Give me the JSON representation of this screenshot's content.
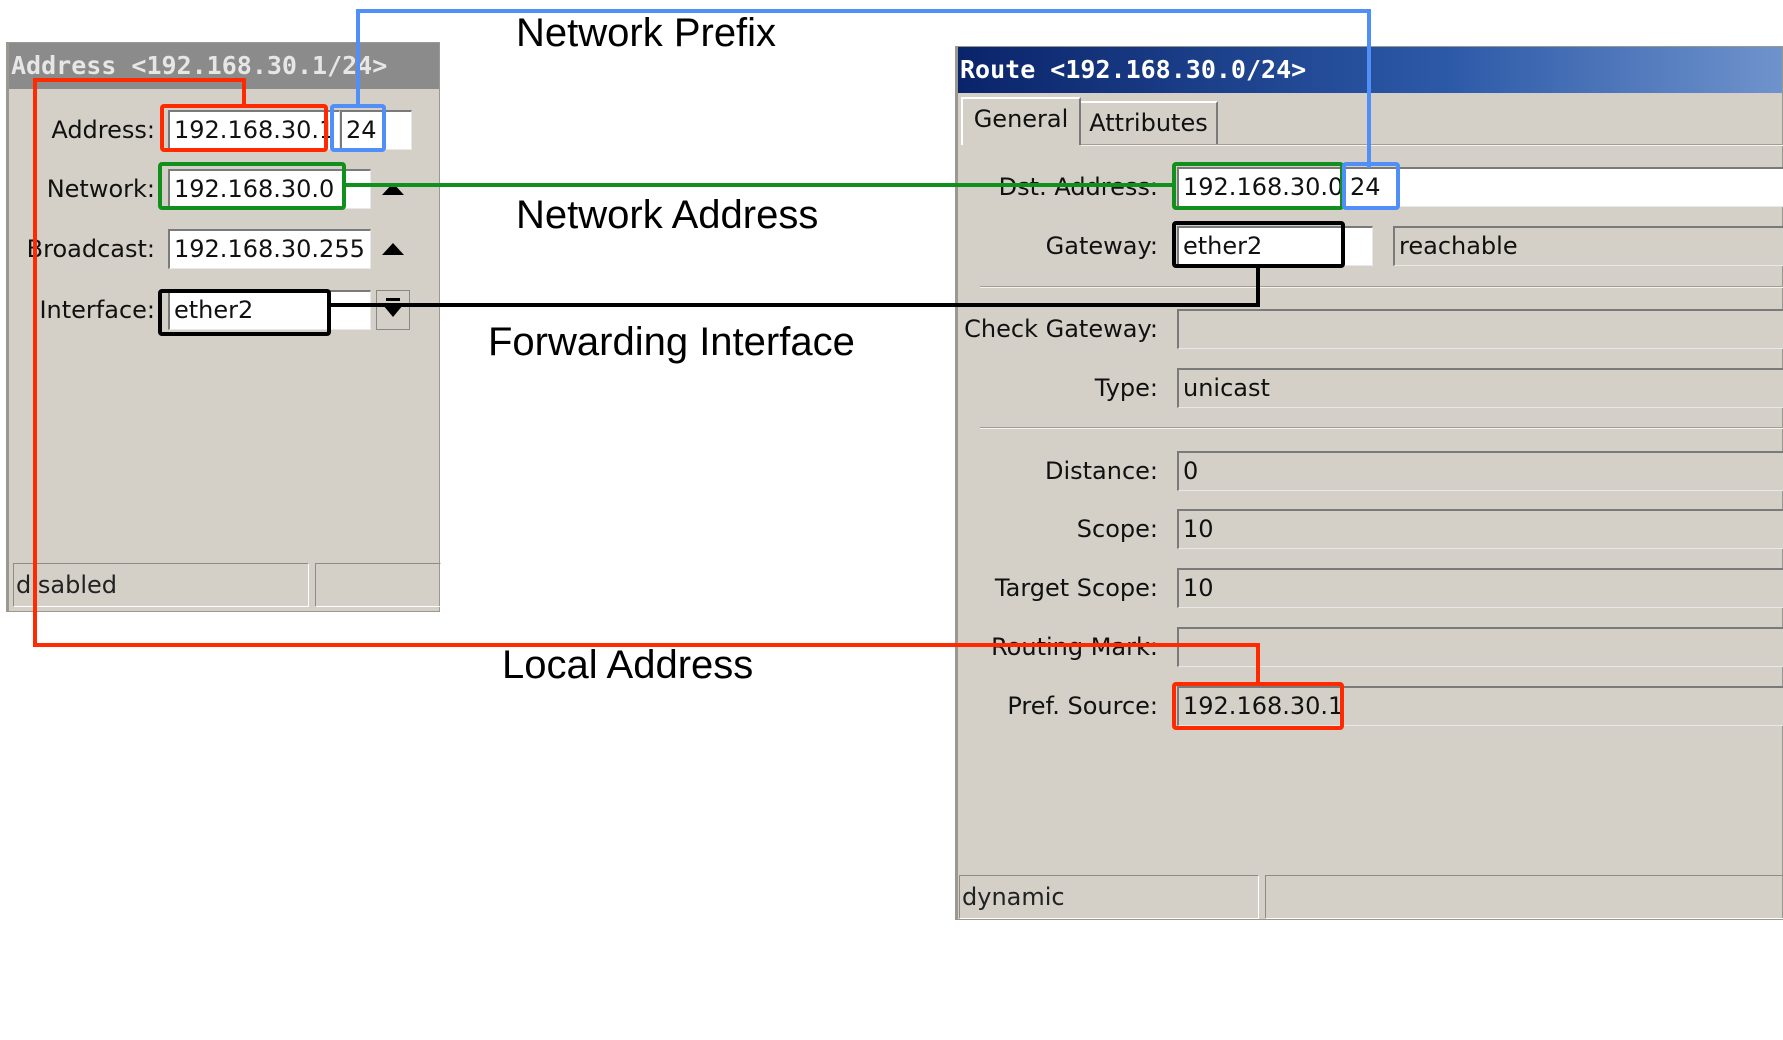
{
  "address_window": {
    "title": "Address <192.168.30.1/24>",
    "fields": {
      "address": {
        "label": "Address:",
        "value": "192.168.30.1",
        "prefix": "24"
      },
      "network": {
        "label": "Network:",
        "value": "192.168.30.0"
      },
      "broadcast": {
        "label": "Broadcast:",
        "value": "192.168.30.255"
      },
      "interface": {
        "label": "Interface:",
        "value": "ether2"
      }
    },
    "status": {
      "left": "disabled",
      "right": ""
    }
  },
  "route_window": {
    "title": "Route <192.168.30.0/24>",
    "tabs": [
      {
        "label": "General",
        "active": true
      },
      {
        "label": "Attributes",
        "active": false
      }
    ],
    "fields": {
      "dst_address": {
        "label": "Dst. Address:",
        "value": "192.168.30.0",
        "prefix": "24"
      },
      "gateway": {
        "label": "Gateway:",
        "value": "ether2",
        "status": "reachable"
      },
      "check_gateway": {
        "label": "Check Gateway:",
        "value": ""
      },
      "type": {
        "label": "Type:",
        "value": "unicast"
      },
      "distance": {
        "label": "Distance:",
        "value": "0"
      },
      "scope": {
        "label": "Scope:",
        "value": "10"
      },
      "target_scope": {
        "label": "Target Scope:",
        "value": "10"
      },
      "routing_mark": {
        "label": "Routing Mark:",
        "value": ""
      },
      "pref_source": {
        "label": "Pref. Source:",
        "value": "192.168.30.1"
      }
    },
    "status": {
      "left": "dynamic",
      "right": ""
    }
  },
  "annotations": {
    "network_prefix": "Network Prefix",
    "network_address": "Network Address",
    "forwarding_interface": "Forwarding Interface",
    "local_address": "Local Address"
  },
  "colors": {
    "title_active": "#0a246a",
    "title_inactive": "#808080",
    "window_bg": "#d4d0c8",
    "highlight_red": "#ff2a00",
    "highlight_blue": "#4f8ff7",
    "highlight_green": "#12901e",
    "highlight_black": "#000000"
  }
}
